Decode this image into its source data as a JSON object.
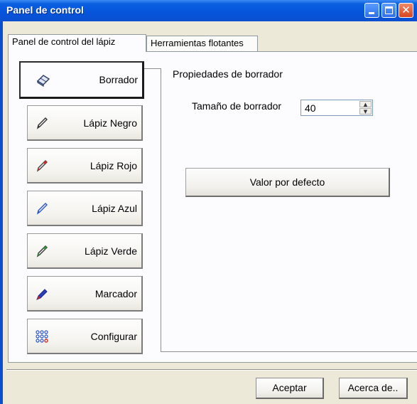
{
  "window": {
    "title": "Panel de control"
  },
  "tabs": [
    {
      "label": "Panel de control del lápiz",
      "active": true
    },
    {
      "label": "Herramientas flotantes",
      "active": false
    }
  ],
  "tools": [
    {
      "label": "Borrador",
      "icon": "eraser-icon",
      "selected": true
    },
    {
      "label": "Lápiz Negro",
      "icon": "black-pencil-icon",
      "color": "#333333"
    },
    {
      "label": "Lápiz Rojo",
      "icon": "red-pencil-icon",
      "color": "#d02b2b"
    },
    {
      "label": "Lápiz Azul",
      "icon": "blue-pencil-icon",
      "color": "#2a56c8"
    },
    {
      "label": "Lápiz Verde",
      "icon": "green-pencil-icon",
      "color": "#2e9a3a"
    },
    {
      "label": "Marcador",
      "icon": "marker-icon",
      "color": "#2a3fb8"
    },
    {
      "label": "Configurar",
      "icon": "settings-grid-icon"
    }
  ],
  "properties": {
    "title": "Propiedades de borrador",
    "size_label": "Tamaño de borrador",
    "size_value": "40",
    "default_button": "Valor por defecto"
  },
  "footer": {
    "accept": "Aceptar",
    "about": "Acerca de.."
  }
}
